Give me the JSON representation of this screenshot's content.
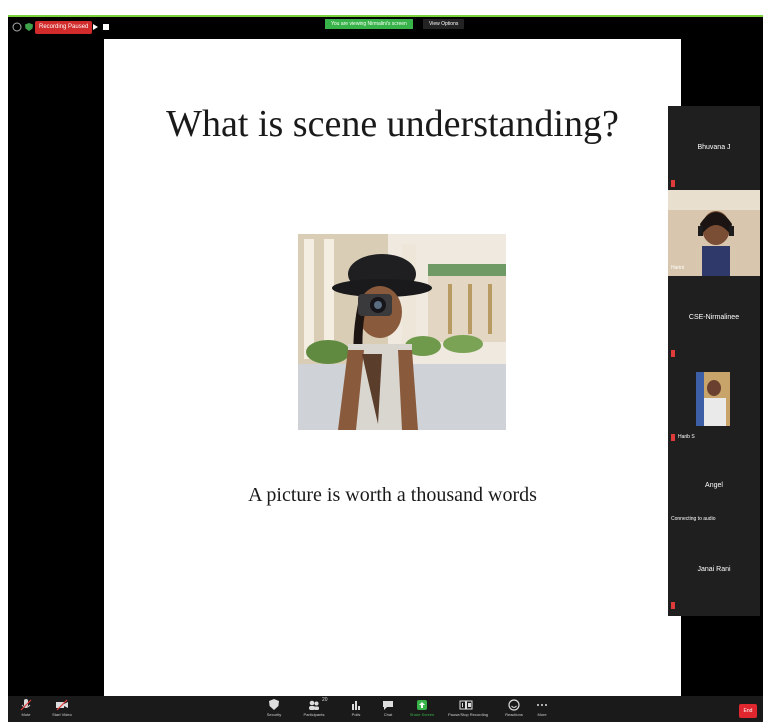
{
  "topbar": {
    "recording_label": "Recording Paused",
    "share_notice": "You are viewing Nirmalini's screen",
    "view_options_label": "View Options"
  },
  "slide": {
    "title": "What is scene understanding?",
    "caption": "A picture is worth a thousand words"
  },
  "participants": [
    {
      "name": "Bhuvana J",
      "muted": true
    },
    {
      "name": "Harini",
      "muted": false
    },
    {
      "name": "CSE-Nirmalinee",
      "muted": true
    },
    {
      "name": "Harib S",
      "muted": true
    },
    {
      "name": "Angel",
      "status": "Connecting to audio",
      "muted": false
    },
    {
      "name": "Janai Rani",
      "muted": true
    }
  ],
  "toolbar": {
    "mute_label": "Mute",
    "video_label": "Start Video",
    "security_label": "Security",
    "participants_label": "Participants",
    "participants_count": "20",
    "polls_label": "Polls",
    "chat_label": "Chat",
    "share_label": "Share Screen",
    "record_label": "Pause/Stop Recording",
    "reactions_label": "Reactions",
    "more_label": "More",
    "end_label": "End"
  },
  "colors": {
    "share_green": "#38b349",
    "record_red": "#d12b2b",
    "end_red": "#e0262e",
    "panel_bg": "#1f1f1f"
  }
}
